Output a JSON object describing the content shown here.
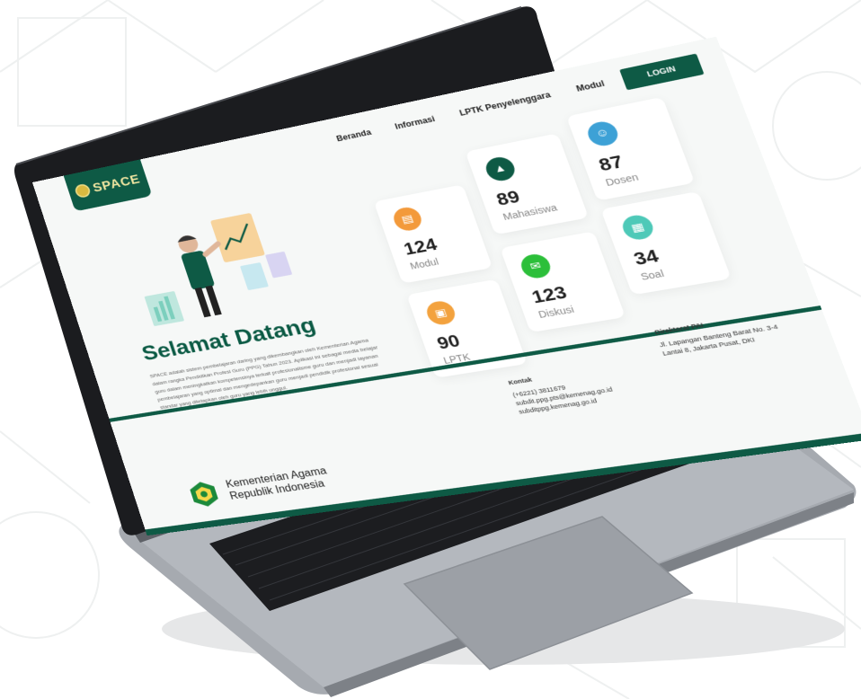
{
  "nav": {
    "logo_text": "SPACE",
    "links": [
      "Beranda",
      "Informasi",
      "LPTK Penyelenggara",
      "Modul"
    ],
    "login_label": "LOGIN"
  },
  "hero": {
    "title": "Selamat Datang",
    "description": "SPACE adalah sistem pembelajaran daring yang dikembangkan oleh Kementerian Agama dalam rangka Pendidikan Profesi Guru (PPG) Tahun 2023. Aplikasi ini sebagai media belajar guru dalam meningkatkan kompetensinya terkait profesionalisme guru dan menjadi layanan pembelajaran yang optimal dan mengedepankan guru menjadi pendidik profesional sesuai standar yang ditetapkan oleh guru yang lebih unggul."
  },
  "stats": [
    {
      "value": "124",
      "label": "Modul",
      "color": "#f39a3b",
      "icon": "book-icon"
    },
    {
      "value": "89",
      "label": "Mahasiswa",
      "color": "#0e5a45",
      "icon": "graduation-cap-icon"
    },
    {
      "value": "87",
      "label": "Dosen",
      "color": "#3da1d6",
      "icon": "teacher-icon"
    },
    {
      "value": "90",
      "label": "LPTK",
      "color": "#f3a23e",
      "icon": "institution-icon"
    },
    {
      "value": "123",
      "label": "Diskusi",
      "color": "#2cbf3a",
      "icon": "discussion-icon"
    },
    {
      "value": "34",
      "label": "Soal",
      "color": "#4ec9b8",
      "icon": "quiz-icon"
    }
  ],
  "contact": {
    "title": "Kontak",
    "phone": "(+6221) 3811679",
    "email1": "subdit.ppg.pts@kemenag.go.id",
    "email2": "subditppg.kemenag.go.id"
  },
  "direktorat": {
    "title": "Direktorat PAI",
    "address": "Jl. Lapangan Banteng Barat No. 3-4 Lantai 8, Jakarta Pusat, DKI"
  },
  "footer": {
    "ministry_line1": "Kementerian Agama",
    "ministry_line2": "Republik Indonesia"
  },
  "laptop": {
    "model": "MacBook Pro"
  },
  "colors": {
    "brand_green": "#0e5a45",
    "laptop_body": "#9ea2a9",
    "keyboard": "#1c1d20"
  }
}
